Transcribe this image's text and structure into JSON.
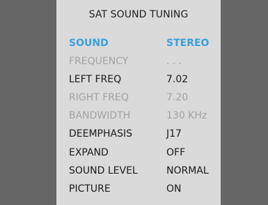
{
  "title": "SAT SOUND TUNING",
  "colors": {
    "background": "#666666",
    "panel": "#dadada",
    "highlight": "#3aa0dc",
    "text": "#1a1a1a",
    "disabled": "#a2a2a2"
  },
  "menu": {
    "items": [
      {
        "label": "SOUND",
        "value": "STEREO",
        "state": "active"
      },
      {
        "label": "FREQUENCY",
        "value": ". . .",
        "state": "disabled"
      },
      {
        "label": "LEFT FREQ",
        "value": "7.02",
        "state": "normal"
      },
      {
        "label": "RIGHT FREQ",
        "value": "7.20",
        "state": "disabled"
      },
      {
        "label": "BANDWIDTH",
        "value": "130 KHz",
        "state": "disabled"
      },
      {
        "label": "DEEMPHASIS",
        "value": "J17",
        "state": "normal"
      },
      {
        "label": "EXPAND",
        "value": "OFF",
        "state": "normal"
      },
      {
        "label": "SOUND LEVEL",
        "value": "NORMAL",
        "state": "normal"
      },
      {
        "label": "PICTURE",
        "value": "ON",
        "state": "normal"
      }
    ]
  }
}
